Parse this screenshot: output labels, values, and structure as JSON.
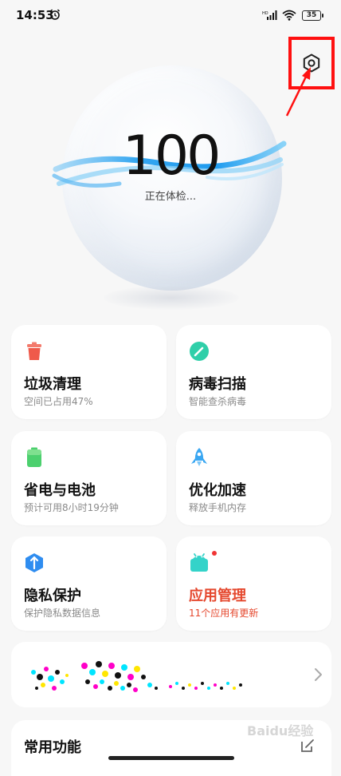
{
  "status_bar": {
    "time": "14:53",
    "battery": "35"
  },
  "hero": {
    "score": "100",
    "status": "正在体检..."
  },
  "cards": [
    {
      "title": "垃圾清理",
      "subtitle": "空间已占用47%",
      "icon": "trash-icon",
      "color": "#f06a5c"
    },
    {
      "title": "病毒扫描",
      "subtitle": "智能查杀病毒",
      "icon": "virus-scan-icon",
      "color": "#2fcfa9"
    },
    {
      "title": "省电与电池",
      "subtitle": "预计可用8小时19分钟",
      "icon": "battery-icon",
      "color": "#4cd06e"
    },
    {
      "title": "优化加速",
      "subtitle": "释放手机内存",
      "icon": "rocket-icon",
      "color": "#3aa7f2"
    },
    {
      "title": "隐私保护",
      "subtitle": "保护隐私数据信息",
      "icon": "privacy-shield-icon",
      "color": "#2f8df0"
    },
    {
      "title": "应用管理",
      "subtitle": "11个应用有更新",
      "icon": "android-app-icon",
      "color": "#34d3c9"
    }
  ],
  "common": {
    "title": "常用功能"
  },
  "watermark": "Baidu经验",
  "colors": {
    "accent_red": "#e5482e",
    "annotation_red": "#ff1010",
    "ring_blue": "#35a6f0"
  }
}
